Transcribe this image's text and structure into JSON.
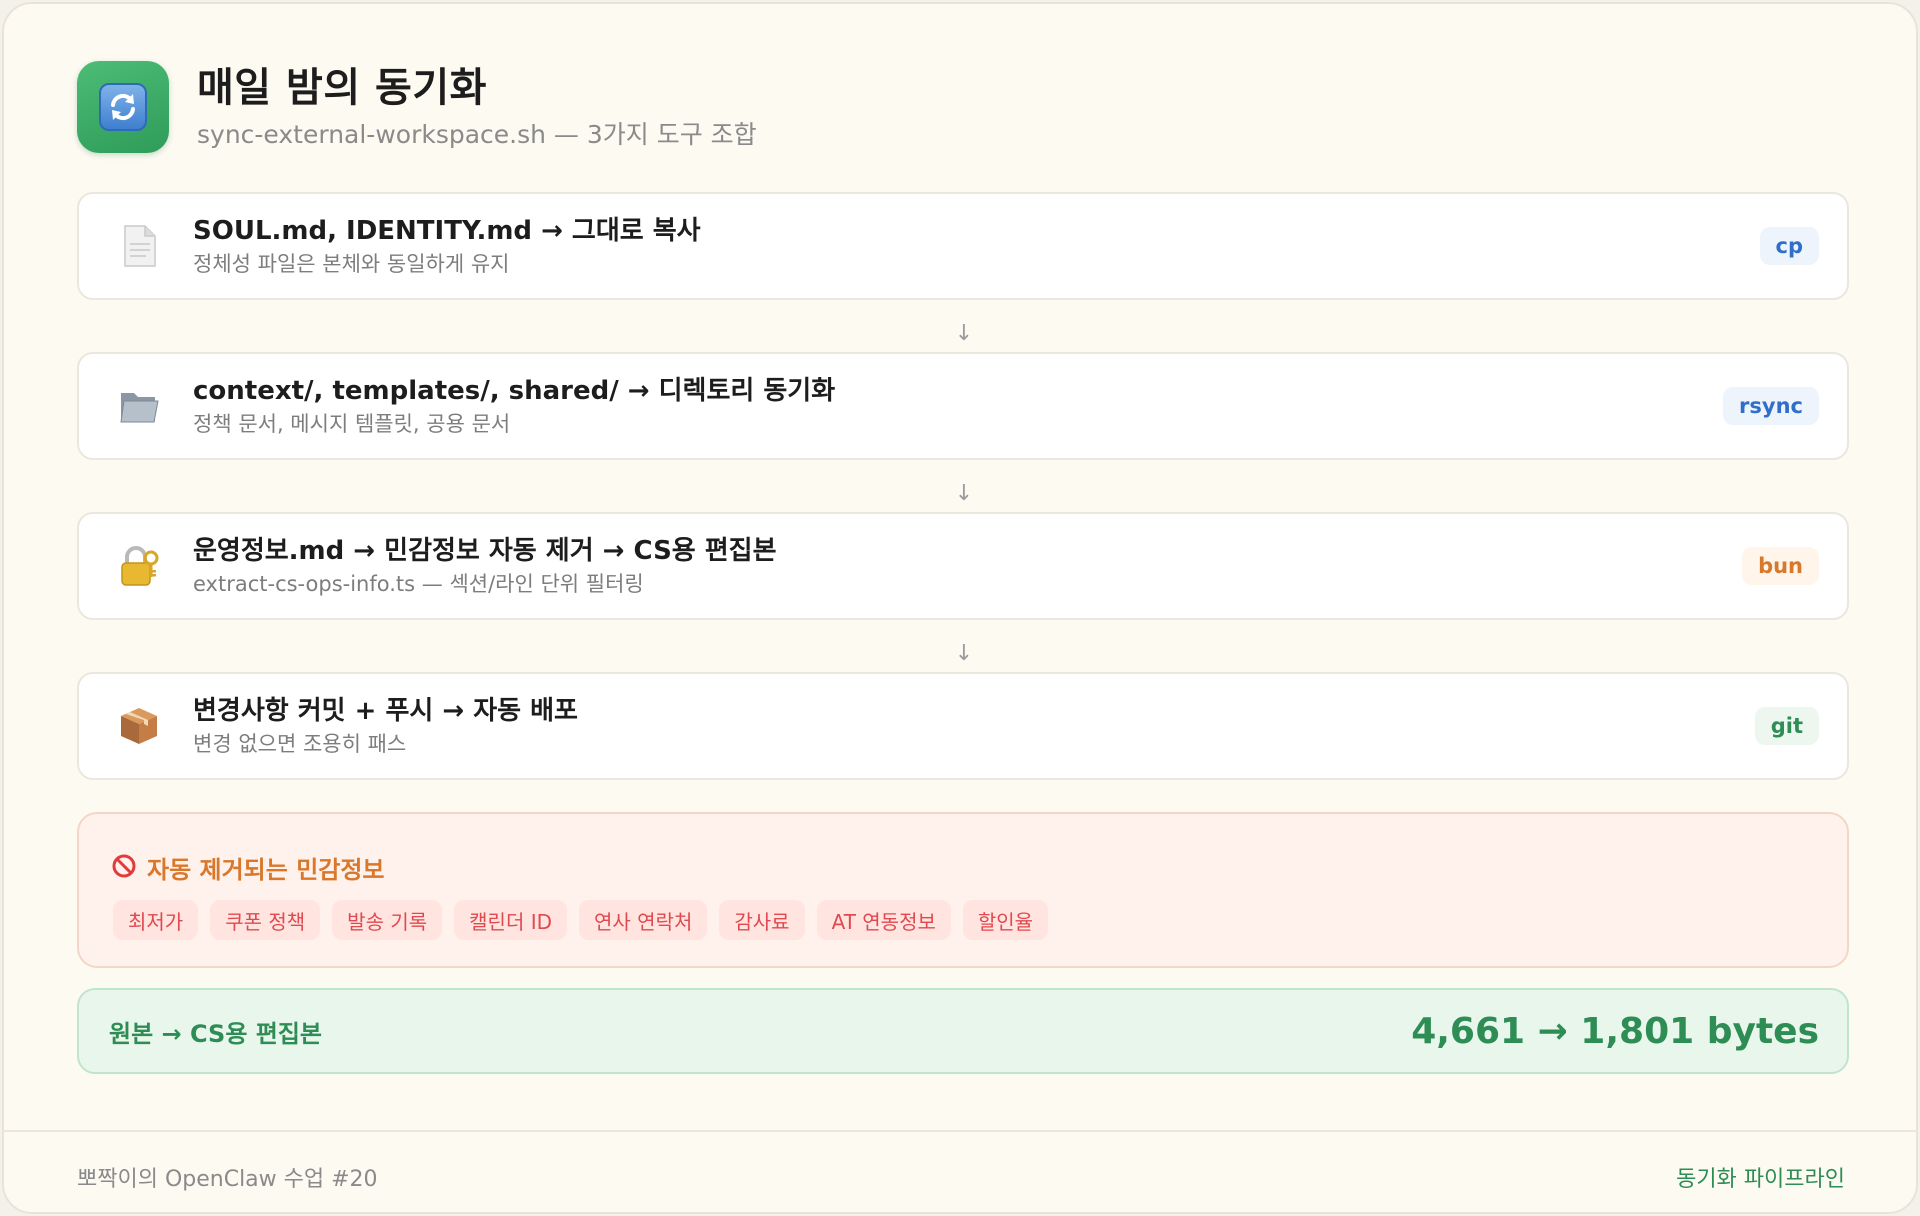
{
  "header": {
    "app_icon": "sync-arrows-icon",
    "title": "매일 밤의 동기화",
    "subtitle": "sync-external-workspace.sh — 3가지 도구 조합"
  },
  "steps": [
    {
      "icon": "document-icon",
      "title": "SOUL.md, IDENTITY.md → 그대로 복사",
      "sub": "정체성 파일은 본체와 동일하게 유지",
      "tag": "cp",
      "tag_color": "#2f6fc9",
      "tag_bg": "#eef4fc"
    },
    {
      "icon": "folder-icon",
      "title": "context/, templates/, shared/ → 디렉토리 동기화",
      "sub": "정책 문서, 메시지 템플릿, 공용 문서",
      "tag": "rsync",
      "tag_color": "#2f6fc9",
      "tag_bg": "#eef4fc"
    },
    {
      "icon": "lock-key-icon",
      "title": "운영정보.md → 민감정보 자동 제거 → CS용 편집본",
      "sub": "extract-cs-ops-info.ts — 섹션/라인 단위 필터링",
      "tag": "bun",
      "tag_color": "#d9772a",
      "tag_bg": "#fff5ea"
    },
    {
      "icon": "package-icon",
      "title": "변경사항 커밋 + 푸시 → 자동 배포",
      "sub": "변경 없으면 조용히 패스",
      "tag": "git",
      "tag_color": "#2e8d54",
      "tag_bg": "#edf7f0"
    }
  ],
  "arrow_glyph": "↓",
  "sensitive": {
    "icon": "prohibited-icon",
    "label": "자동 제거되는 민감정보",
    "chips": [
      "최저가",
      "쿠폰 정책",
      "발송 기록",
      "캘린더 ID",
      "연사 연락처",
      "감사료",
      "AT 연동정보",
      "할인율"
    ]
  },
  "result": {
    "label": "원본 → CS용 편집본",
    "value": "4,661 → 1,801 bytes"
  },
  "footer": {
    "left": "뽀짝이의 OpenClaw 수업 #20",
    "right": "동기화 파이프라인"
  }
}
